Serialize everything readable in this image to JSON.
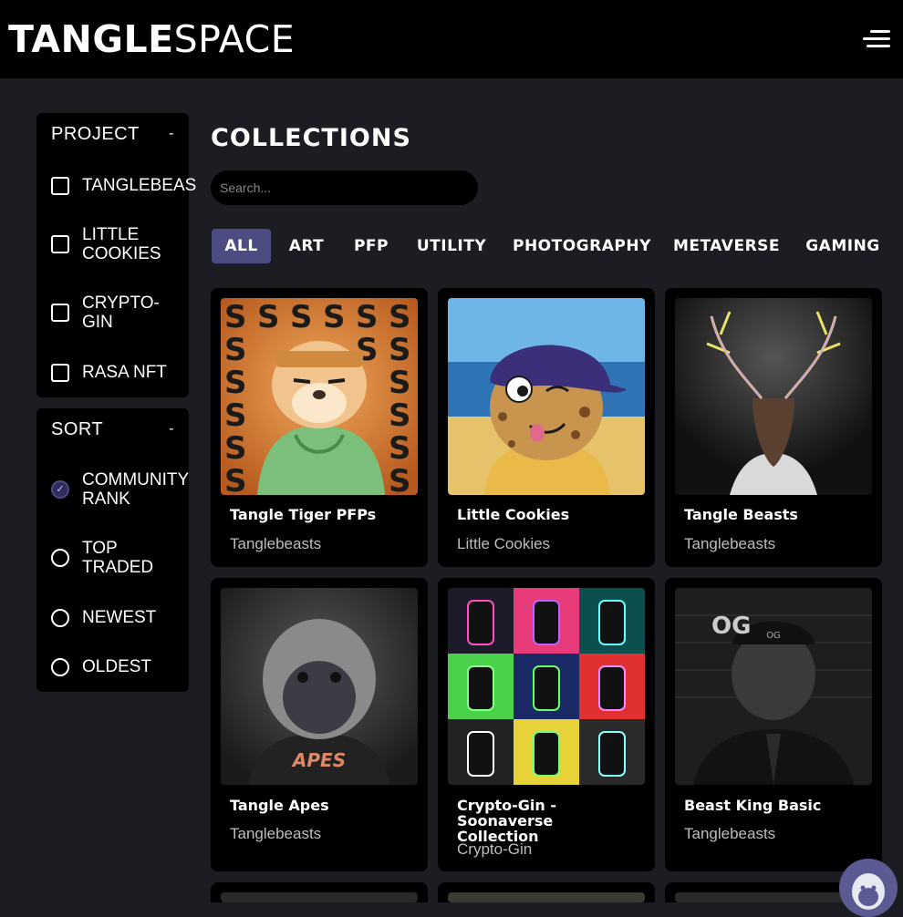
{
  "header": {
    "logo_bold": "TANGLE",
    "logo_light": "SPACE"
  },
  "project_panel": {
    "title": "PROJECT",
    "toggle": "-",
    "items": [
      {
        "label": "TANGLEBEAS"
      },
      {
        "label": "LITTLE COOKIES"
      },
      {
        "label": "CRYPTO-GIN"
      },
      {
        "label": "RASA NFT"
      }
    ]
  },
  "sort_panel": {
    "title": "SORT",
    "toggle": "-",
    "options": [
      {
        "label": "COMMUNITY RANK",
        "selected": true
      },
      {
        "label": "TOP TRADED",
        "selected": false
      },
      {
        "label": "NEWEST",
        "selected": false
      },
      {
        "label": "OLDEST",
        "selected": false
      }
    ]
  },
  "main": {
    "title": "COLLECTIONS",
    "search_placeholder": "Search...",
    "filters": [
      "ALL",
      "ART",
      "PFP",
      "UTILITY",
      "PHOTOGRAPHY",
      "METAVERSE",
      "GAMING"
    ],
    "active_filter": "ALL"
  },
  "collections": [
    {
      "name": "Tangle Tiger PFPs",
      "creator": "Tanglebeasts"
    },
    {
      "name": "Little Cookies",
      "creator": "Little Cookies"
    },
    {
      "name": "Tangle Beasts",
      "creator": "Tanglebeasts"
    },
    {
      "name": "Tangle Apes",
      "creator": "Tanglebeasts"
    },
    {
      "name": "Crypto-Gin - Soonaverse Collection",
      "creator": "Crypto-Gin"
    },
    {
      "name": "Beast King Basic",
      "creator": "Tanglebeasts"
    }
  ],
  "colors": {
    "background": "#1b1d22",
    "panel": "#000000",
    "accent": "#4c4c82",
    "muted_text": "#bdbdbd"
  }
}
